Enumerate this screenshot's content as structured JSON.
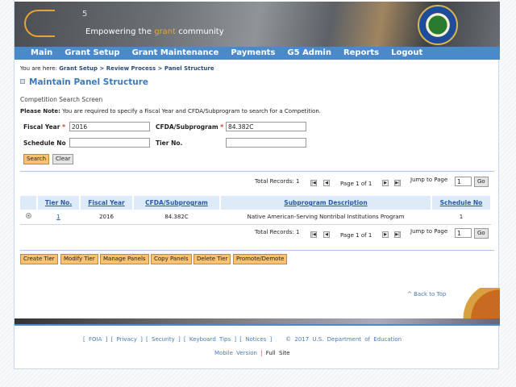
{
  "header": {
    "logo_text": "G",
    "logo_superscript": "5",
    "tagline_pre": "Empowering the ",
    "tagline_highlight": "grant",
    "tagline_post": " community",
    "seal": "Department of Education seal"
  },
  "nav": [
    "Main",
    "Grant Setup",
    "Grant Maintenance",
    "Payments",
    "G5 Admin",
    "Reports",
    "Logout"
  ],
  "breadcrumb": {
    "prefix": "You are here:",
    "path": "Grant Setup > Review Process > Panel Structure"
  },
  "page_title": "Maintain Panel Structure",
  "section_title": "Competition Search Screen",
  "note": {
    "label": "Please Note:",
    "text": " You are required to specify a Fiscal Year and CFDA/Subprogram to search for a Competition."
  },
  "form": {
    "fiscal_year_label": "Fiscal Year",
    "fiscal_year": "2016",
    "cfda_label": "CFDA/Subprogram",
    "cfda": "84.382C",
    "schedule_label": "Schedule No",
    "schedule": "",
    "tier_label": "Tier No.",
    "tier": "",
    "required": "*",
    "search": "Search",
    "clear": "Clear"
  },
  "pagination": {
    "total": "Total Records: 1",
    "page": "Page 1 of 1",
    "jump_label": "Jump to Page",
    "jump_value": "1",
    "go": "Go"
  },
  "table": {
    "headers": [
      "Tier No.",
      "Fiscal Year",
      "CFDA/Subprogram",
      "Subprogram Description",
      "Schedule No"
    ],
    "rows": [
      {
        "tier": "1",
        "fiscal_year": "2016",
        "cfda": "84.382C",
        "description": "Native American-Serving Nontribal Institutions Program",
        "schedule": "1"
      }
    ]
  },
  "actions": [
    "Create Tier",
    "Modify Tier",
    "Manage Panels",
    "Copy Panels",
    "Delete Tier",
    "Promote/Demote"
  ],
  "back_to_top": "^ Back to Top",
  "footer": {
    "links": [
      "FOIA",
      "Privacy",
      "Security",
      "Keyboard Tips",
      "Notices"
    ],
    "copyright": "© 2017 U.S. Department of Education",
    "mobile": "Mobile Version",
    "sep": "|",
    "full": "Full Site"
  },
  "colors": {
    "nav": "#4a8acb",
    "button": "#f8c270",
    "title": "#3a7ac0"
  }
}
